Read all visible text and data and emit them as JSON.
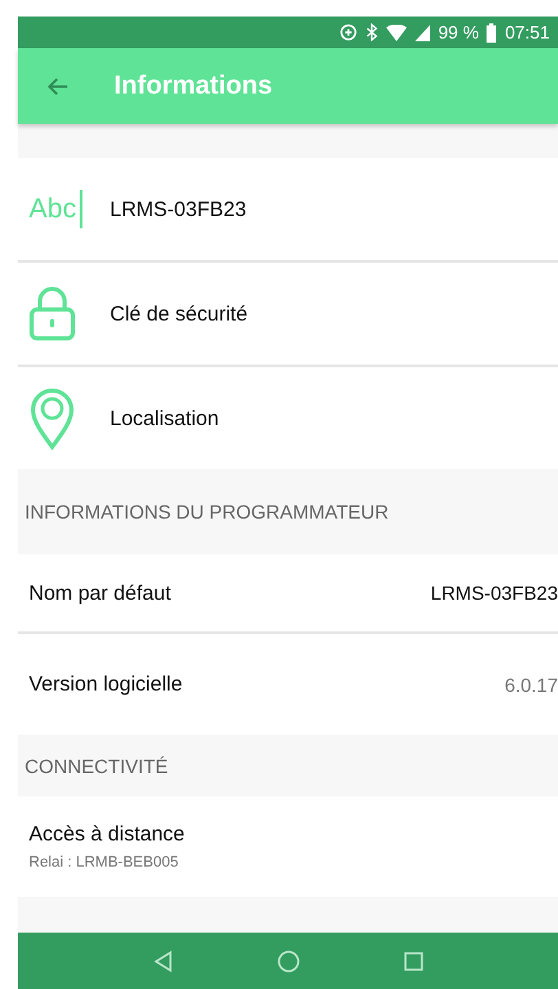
{
  "status_bar": {
    "battery": "99 %",
    "time": "07:51"
  },
  "app_bar": {
    "title": "Informations"
  },
  "items": [
    {
      "kind": "name",
      "icon_text": "Abc",
      "label": "LRMS-03FB23"
    },
    {
      "kind": "lock",
      "label": "Clé de sécurité"
    },
    {
      "kind": "location",
      "label": "Localisation"
    }
  ],
  "sections": [
    {
      "header": "INFORMATIONS DU PROGRAMMATEUR",
      "rows": [
        {
          "label": "Nom par défaut",
          "value": "LRMS-03FB23",
          "strong": true
        },
        {
          "label": "Version logicielle",
          "value": "6.0.17",
          "strong": false
        }
      ]
    },
    {
      "header": "CONNECTIVITÉ",
      "rows": [
        {
          "label": "Accès à distance",
          "subtitle": "Relai : LRMB-BEB005"
        }
      ]
    }
  ]
}
